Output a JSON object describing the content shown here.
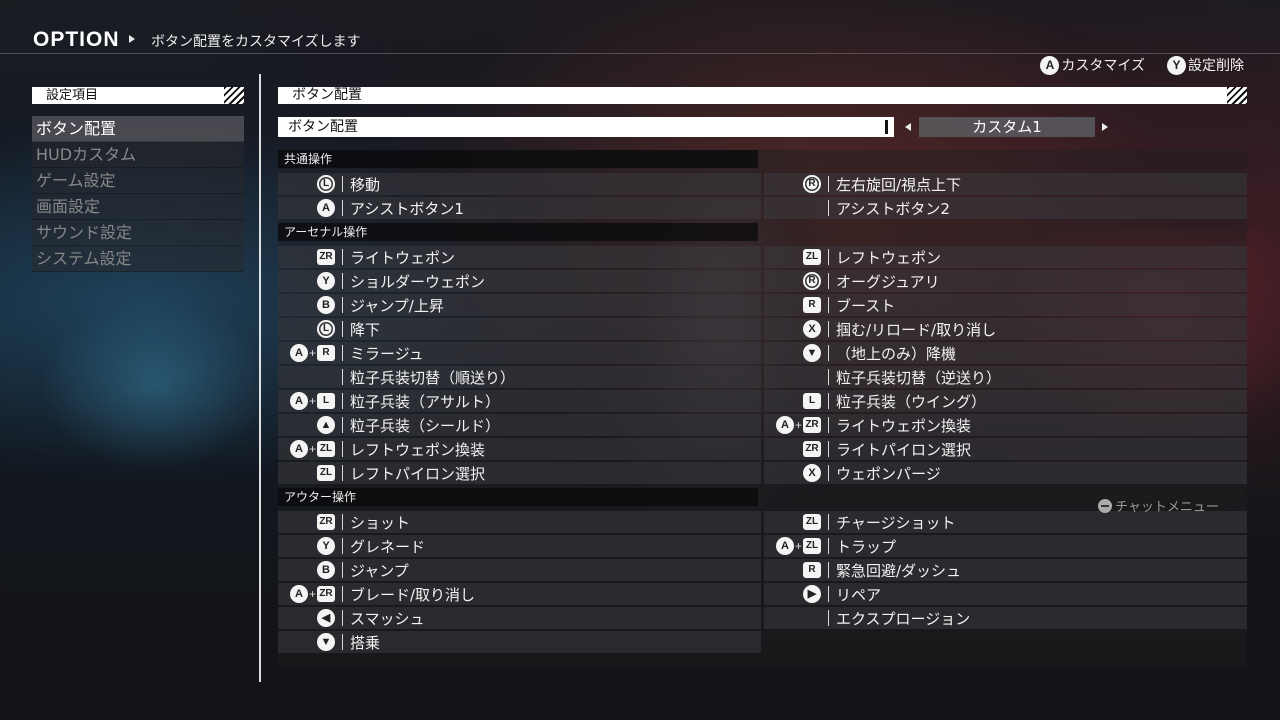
{
  "header": {
    "title": "OPTION",
    "description": "ボタン配置をカスタマイズします"
  },
  "hints": [
    {
      "button": "A",
      "label": "カスタマイズ"
    },
    {
      "button": "Y",
      "label": "設定削除"
    }
  ],
  "sidebar": {
    "heading": "設定項目",
    "items": [
      {
        "label": "ボタン配置",
        "active": true
      },
      {
        "label": "HUDカスタム",
        "active": false
      },
      {
        "label": "ゲーム設定",
        "active": false
      },
      {
        "label": "画面設定",
        "active": false
      },
      {
        "label": "サウンド設定",
        "active": false
      },
      {
        "label": "システム設定",
        "active": false
      }
    ]
  },
  "main": {
    "heading": "ボタン配置",
    "preset_field": "ボタン配置",
    "preset_value": "カスタム1"
  },
  "sections": [
    {
      "label": "共通操作",
      "left": [
        {
          "icons": [
            {
              "t": "stick",
              "g": "L"
            }
          ],
          "label": "移動"
        },
        {
          "icons": [
            {
              "t": "circle",
              "g": "A"
            }
          ],
          "label": "アシストボタン1"
        }
      ],
      "right": [
        {
          "icons": [
            {
              "t": "stick",
              "g": "R"
            }
          ],
          "label": "左右旋回/視点上下"
        },
        {
          "icons": [],
          "label": "アシストボタン2"
        }
      ]
    },
    {
      "label": "アーセナル操作",
      "left": [
        {
          "icons": [
            {
              "t": "rect",
              "g": "ZR"
            }
          ],
          "label": "ライトウェポン"
        },
        {
          "icons": [
            {
              "t": "circle",
              "g": "Y"
            }
          ],
          "label": "ショルダーウェポン"
        },
        {
          "icons": [
            {
              "t": "circle",
              "g": "B"
            }
          ],
          "label": "ジャンプ/上昇"
        },
        {
          "icons": [
            {
              "t": "stick",
              "g": "L"
            }
          ],
          "label": "降下"
        },
        {
          "icons": [
            {
              "t": "circle",
              "g": "A"
            },
            {
              "t": "plus",
              "g": "+"
            },
            {
              "t": "rect",
              "g": "R"
            }
          ],
          "label": "ミラージュ"
        },
        {
          "icons": [],
          "label": "粒子兵装切替（順送り）"
        },
        {
          "icons": [
            {
              "t": "circle",
              "g": "A"
            },
            {
              "t": "plus",
              "g": "+"
            },
            {
              "t": "rect",
              "g": "L"
            }
          ],
          "label": "粒子兵装（アサルト）"
        },
        {
          "icons": [
            {
              "t": "circle",
              "g": "▲"
            }
          ],
          "label": "粒子兵装（シールド）"
        },
        {
          "icons": [
            {
              "t": "circle",
              "g": "A"
            },
            {
              "t": "plus",
              "g": "+"
            },
            {
              "t": "rect",
              "g": "ZL"
            }
          ],
          "label": "レフトウェポン換装"
        },
        {
          "icons": [
            {
              "t": "rect",
              "g": "ZL"
            }
          ],
          "label": "レフトパイロン選択"
        }
      ],
      "right": [
        {
          "icons": [
            {
              "t": "rect",
              "g": "ZL"
            }
          ],
          "label": "レフトウェポン"
        },
        {
          "icons": [
            {
              "t": "stick",
              "g": "R"
            }
          ],
          "label": "オーグジュアリ"
        },
        {
          "icons": [
            {
              "t": "rect",
              "g": "R"
            }
          ],
          "label": "ブースト"
        },
        {
          "icons": [
            {
              "t": "circle",
              "g": "X"
            }
          ],
          "label": "掴む/リロード/取り消し"
        },
        {
          "icons": [
            {
              "t": "circle",
              "g": "▼"
            }
          ],
          "label": "（地上のみ）降機"
        },
        {
          "icons": [],
          "label": "粒子兵装切替（逆送り）"
        },
        {
          "icons": [
            {
              "t": "rect",
              "g": "L"
            }
          ],
          "label": "粒子兵装（ウイング）"
        },
        {
          "icons": [
            {
              "t": "circle",
              "g": "A"
            },
            {
              "t": "plus",
              "g": "+"
            },
            {
              "t": "rect",
              "g": "ZR"
            }
          ],
          "label": "ライトウェポン換装"
        },
        {
          "icons": [
            {
              "t": "rect",
              "g": "ZR"
            }
          ],
          "label": "ライトパイロン選択"
        },
        {
          "icons": [
            {
              "t": "circle",
              "g": "X"
            }
          ],
          "label": "ウェポンパージ"
        }
      ]
    },
    {
      "label": "アウター操作",
      "left": [
        {
          "icons": [
            {
              "t": "rect",
              "g": "ZR"
            }
          ],
          "label": "ショット"
        },
        {
          "icons": [
            {
              "t": "circle",
              "g": "Y"
            }
          ],
          "label": "グレネード"
        },
        {
          "icons": [
            {
              "t": "circle",
              "g": "B"
            }
          ],
          "label": "ジャンプ"
        },
        {
          "icons": [
            {
              "t": "circle",
              "g": "A"
            },
            {
              "t": "plus",
              "g": "+"
            },
            {
              "t": "rect",
              "g": "ZR"
            }
          ],
          "label": "ブレード/取り消し"
        },
        {
          "icons": [
            {
              "t": "circle",
              "g": "◀"
            }
          ],
          "label": "スマッシュ"
        },
        {
          "icons": [
            {
              "t": "circle",
              "g": "▼"
            }
          ],
          "label": "搭乗"
        }
      ],
      "right": [
        {
          "icons": [
            {
              "t": "rect",
              "g": "ZL"
            }
          ],
          "label": "チャージショット"
        },
        {
          "icons": [
            {
              "t": "circle",
              "g": "A"
            },
            {
              "t": "plus",
              "g": "+"
            },
            {
              "t": "rect",
              "g": "ZL"
            }
          ],
          "label": "トラップ"
        },
        {
          "icons": [
            {
              "t": "rect",
              "g": "R"
            }
          ],
          "label": "緊急回避/ダッシュ"
        },
        {
          "icons": [
            {
              "t": "circle",
              "g": "▶"
            }
          ],
          "label": "リペア"
        },
        {
          "icons": [],
          "label": "エクスプロージョン"
        }
      ]
    }
  ],
  "chat_hint": "チャットメニュー"
}
